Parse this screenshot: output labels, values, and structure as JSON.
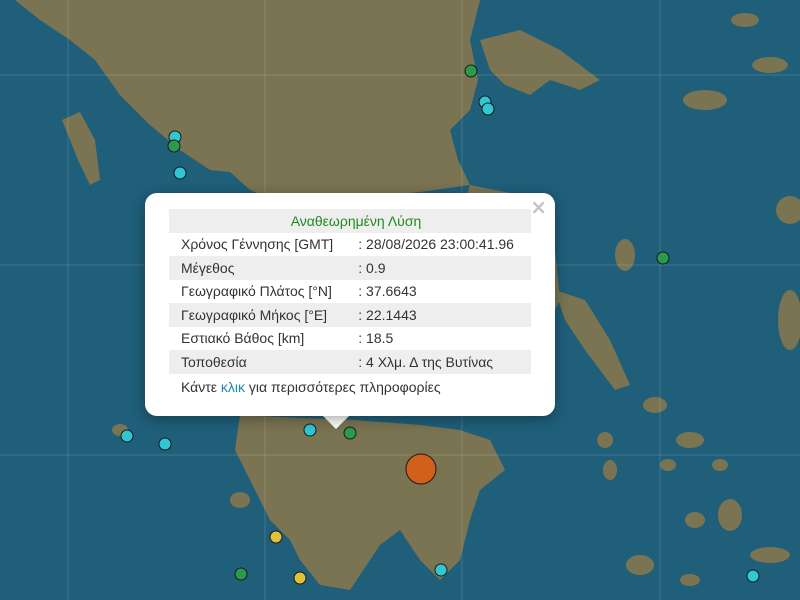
{
  "popup": {
    "close_glyph": "×",
    "title": "Αναθεωρημένη Λύση",
    "rows": [
      {
        "label": "Χρόνος Γέννησης [GMT]",
        "value": ": 28/08/2026 23:00:41.96"
      },
      {
        "label": "Μέγεθος",
        "value": ": 0.9"
      },
      {
        "label": "Γεωγραφικό Πλάτος [°N]",
        "value": ": 37.6643"
      },
      {
        "label": "Γεωγραφικό Μήκος [°E]",
        "value": ": 22.1443"
      },
      {
        "label": "Εστιακό Βάθος [km]",
        "value": ": 18.5"
      },
      {
        "label": "Τοποθεσία",
        "value": ": 4 Χλμ. Δ της Βυτίνας"
      }
    ],
    "more_prefix": "Κάντε ",
    "more_link": "κλικ",
    "more_suffix": " για περισσότερες πληροφορίες"
  },
  "colors": {
    "sea": "#1f5f7a",
    "land": "#7c7656",
    "marker_cyan": "#2fc7d2",
    "marker_green": "#2a9b4c",
    "marker_yellow": "#e0c23a",
    "marker_orange": "#d2601a",
    "title_green": "#1f8a1f",
    "link_blue": "#1e88a8"
  }
}
